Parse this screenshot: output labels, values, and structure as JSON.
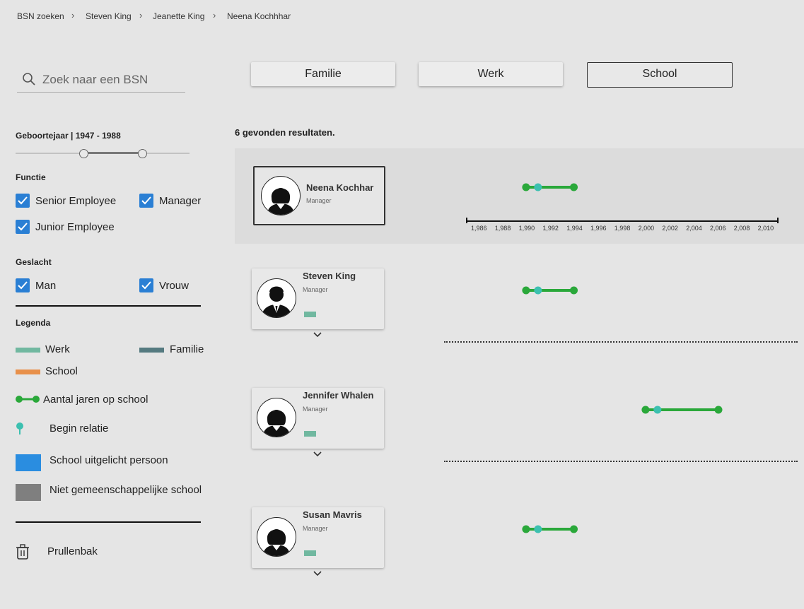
{
  "breadcrumb": [
    "BSN zoeken",
    "Steven King",
    "Jeanette King",
    "Neena Kochhhar"
  ],
  "search": {
    "placeholder": "Zoek naar een BSN"
  },
  "tabs": [
    {
      "label": "Familie",
      "active": false
    },
    {
      "label": "Werk",
      "active": false
    },
    {
      "label": "School",
      "active": true
    }
  ],
  "filters": {
    "birth_year_label": "Geboortejaar | 1947 - 1988",
    "birth_year_range": [
      1947,
      1988
    ],
    "function_title": "Functie",
    "functions": [
      {
        "label": "Senior Employee",
        "checked": true
      },
      {
        "label": "Manager",
        "checked": true
      },
      {
        "label": "Junior Employee",
        "checked": true
      }
    ],
    "gender_title": "Geslacht",
    "genders": [
      {
        "label": "Man",
        "checked": true
      },
      {
        "label": "Vrouw",
        "checked": true
      }
    ]
  },
  "legend": {
    "title": "Legenda",
    "items": [
      {
        "label": "Werk",
        "color": "#71b8a0"
      },
      {
        "label": "Familie",
        "color": "#557a80"
      },
      {
        "label": "School",
        "color": "#e8904a"
      },
      {
        "label": "Aantal jaren op school",
        "color": "#2aa83a"
      },
      {
        "label": "Begin relatie",
        "color": "#3cc0b0"
      },
      {
        "label": "School uitgelicht persoon",
        "color": "#2a8de0"
      },
      {
        "label": "Niet gemeenschappelijke school",
        "color": "#7f7f7f"
      }
    ]
  },
  "trash": {
    "label": "Prullenbak"
  },
  "results": {
    "count_text": "6 gevonden resultaten.",
    "axis_ticks": [
      "1,986",
      "1,988",
      "1,990",
      "1,992",
      "1,994",
      "1,996",
      "1,998",
      "2,000",
      "2,002",
      "2,004",
      "2,006",
      "2,008",
      "2,010"
    ],
    "persons": [
      {
        "name": "Neena Kochhar",
        "role": "Manager",
        "gender": "female",
        "school_start": 1989.9,
        "school_end": 1993.9,
        "relation_begin": 1990.9
      },
      {
        "name": "Steven King",
        "role": "Manager",
        "gender": "male",
        "school_start": 1989.9,
        "school_end": 1993.9,
        "relation_begin": 1990.9
      },
      {
        "name": "Jennifer Whalen",
        "role": "Manager",
        "gender": "female",
        "school_start": 1999.9,
        "school_end": 2006.0,
        "relation_begin": 2000.9
      },
      {
        "name": "Susan Mavris",
        "role": "Manager",
        "gender": "female",
        "school_start": 1989.9,
        "school_end": 1993.9,
        "relation_begin": 1990.9
      }
    ]
  },
  "colors": {
    "accent": "#2a7fd4",
    "school_line": "#2aa83a",
    "relation_dot": "#3cc0b0"
  }
}
